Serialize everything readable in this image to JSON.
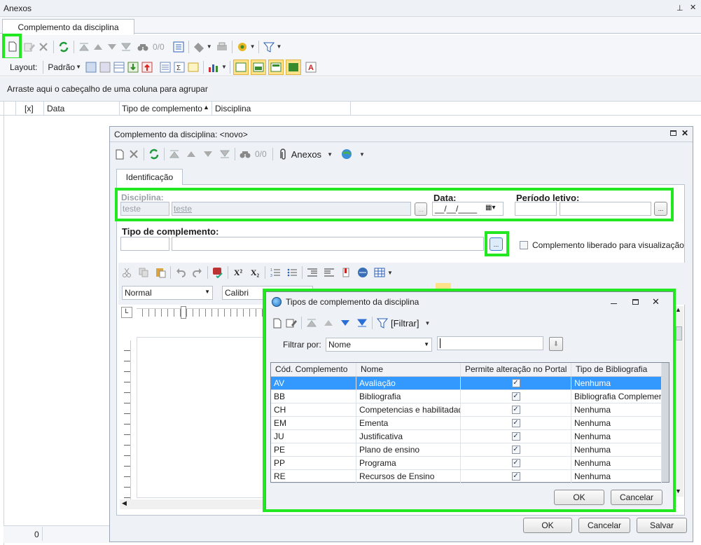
{
  "main_panel": {
    "title": "Anexos",
    "pin_glyph": "⊥",
    "close_glyph": "✕"
  },
  "tab": {
    "label": "Complemento da disciplina"
  },
  "toolbar1": {
    "record_counter": "0/0"
  },
  "toolbar2": {
    "layout_label": "Layout:",
    "layout_value": "Padrão"
  },
  "grid": {
    "group_hint": "Arraste aqui o cabeçalho de uma coluna para agrupar",
    "columns": [
      "[x]",
      "Data",
      "Tipo de complemento",
      "Disciplina"
    ],
    "footer_count": "0"
  },
  "form": {
    "title": "Complemento da disciplina: <novo>",
    "record_counter": "0/0",
    "anexos_label": "Anexos",
    "tab_label": "Identificação",
    "disciplina_label": "Disciplina:",
    "disciplina_code": "teste",
    "disciplina_name": "teste",
    "data_label": "Data:",
    "data_value": "__/__/____",
    "periodo_label": "Período letivo:",
    "tipo_label": "Tipo de complemento:",
    "liberado_label": "Complemento liberado para visualização",
    "lookup_glyph": "...",
    "style_value": "Normal",
    "font_value": "Calibri",
    "ok": "OK",
    "cancel": "Cancelar",
    "save": "Salvar"
  },
  "dialog": {
    "title": "Tipos de complemento da disciplina",
    "filter_button": "[Filtrar]",
    "filter_by_label": "Filtrar por:",
    "filter_by_value": "Nome",
    "search_value": "",
    "columns": [
      "Cód. Complemento",
      "Nome",
      "Permite alteração no Portal",
      "Tipo de Bibliografia"
    ],
    "rows": [
      {
        "code": "AV",
        "name": "Avaliação",
        "portal": true,
        "biblio": "Nenhuma"
      },
      {
        "code": "BB",
        "name": "Bibliografia",
        "portal": true,
        "biblio": "Bibliografia Complementar"
      },
      {
        "code": "CH",
        "name": "Competencias e habilitadades",
        "portal": true,
        "biblio": "Nenhuma"
      },
      {
        "code": "EM",
        "name": "Ementa",
        "portal": true,
        "biblio": "Nenhuma"
      },
      {
        "code": "JU",
        "name": "Justificativa",
        "portal": true,
        "biblio": "Nenhuma"
      },
      {
        "code": "PE",
        "name": "Plano de ensino",
        "portal": true,
        "biblio": "Nenhuma"
      },
      {
        "code": "PP",
        "name": "Programa",
        "portal": true,
        "biblio": "Nenhuma"
      },
      {
        "code": "RE",
        "name": "Recursos de Ensino",
        "portal": true,
        "biblio": "Nenhuma"
      }
    ],
    "selected_row": 0,
    "ok": "OK",
    "cancel": "Cancelar"
  },
  "colors": {
    "highlight": "#22e822",
    "selection": "#3399ff",
    "panel_bg": "#eef1f5",
    "header_bg": "#f0f2f5"
  }
}
